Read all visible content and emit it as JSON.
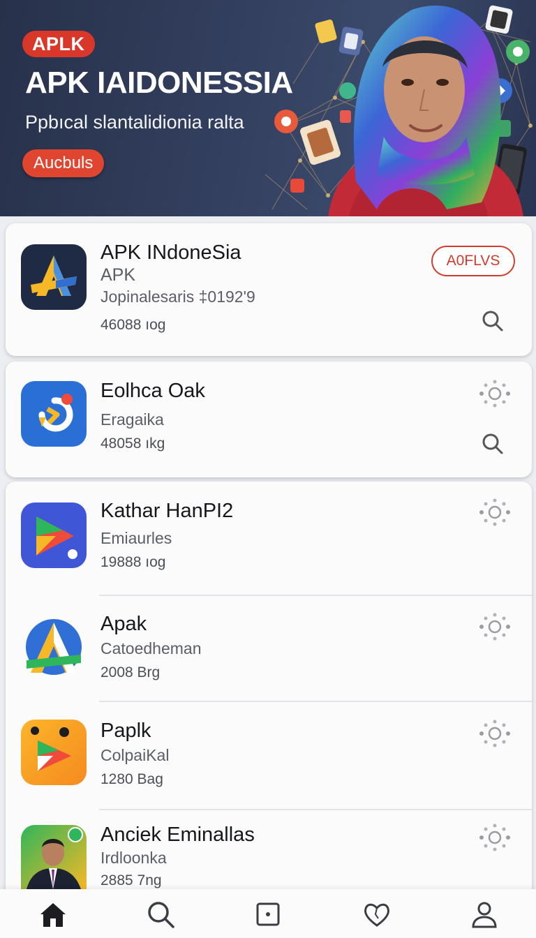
{
  "hero": {
    "badge": "APLK",
    "title": "APK IAIDONESSIA",
    "subtitle": "Ppbıcal slantalidionia ralta",
    "button_label": "Aucbuls"
  },
  "featured": {
    "name": "APK INdoneSia",
    "category": "APK",
    "meta": "Jopinalesaris ‡0192'9",
    "size": "46088 ıog",
    "action_label": "A0FLVS",
    "icon": "apk-indonesia-logo-icon",
    "accent": "#d23b2c"
  },
  "apps": [
    {
      "name": "Eolhca Oak",
      "category": "Eragaika",
      "size": "48058 ıkg",
      "icon": "refresh-app-icon"
    },
    {
      "name": "Kathar HanPI2",
      "category": "Emiaurles",
      "size": "19888 ıog",
      "icon": "play-arrow-app-icon"
    },
    {
      "name": "Apak",
      "category": "Catoedheman",
      "size": "2008 Brg",
      "icon": "a-logo-app-icon"
    },
    {
      "name": "Paplk",
      "category": "ColpaiKal",
      "size": "1280 Bag",
      "icon": "orange-play-app-icon"
    },
    {
      "name": "Anciek Eminallas",
      "category": "Irdloonka",
      "size": "2885 7ng",
      "icon": "portrait-app-icon"
    }
  ],
  "nav": [
    "home-icon",
    "search-icon",
    "apps-icon",
    "favorites-icon",
    "profile-icon"
  ],
  "colors": {
    "brand_red": "#d9372a",
    "hero_bg": "#2f3a56",
    "card_bg": "#fbfbfc"
  }
}
